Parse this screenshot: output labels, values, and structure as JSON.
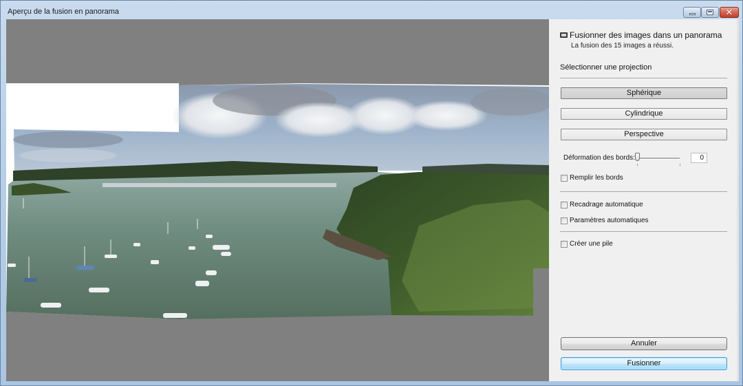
{
  "window": {
    "title": "Aperçu de la fusion en panorama",
    "controls": {
      "minimize": "minimize",
      "maximize": "maximize",
      "close": "✕"
    }
  },
  "preview": {
    "description": "Panoramic photo preview of a harbor bay with moored sailboats, wooded shoreline and cloudy sky"
  },
  "panel": {
    "header": {
      "icon": "panorama-icon",
      "title": "Fusionner des images dans un panorama",
      "status": "La fusion des 15 images a réussi."
    },
    "projection": {
      "label": "Sélectionner une projection",
      "options": [
        {
          "label": "Sphérique",
          "selected": true
        },
        {
          "label": "Cylindrique",
          "selected": false
        },
        {
          "label": "Perspective",
          "selected": false
        }
      ]
    },
    "boundary_warp": {
      "label": "Déformation des bords:",
      "value": "0",
      "slider_fraction": 0
    },
    "checkboxes": {
      "fill_edges": {
        "label": "Remplir les bords",
        "checked": false
      },
      "auto_crop": {
        "label": "Recadrage automatique",
        "checked": false
      },
      "auto_settings": {
        "label": "Paramètres automatiques",
        "checked": false
      },
      "create_stack": {
        "label": "Créer une pile",
        "checked": false
      }
    },
    "buttons": {
      "cancel": "Annuler",
      "merge": "Fusionner"
    }
  }
}
